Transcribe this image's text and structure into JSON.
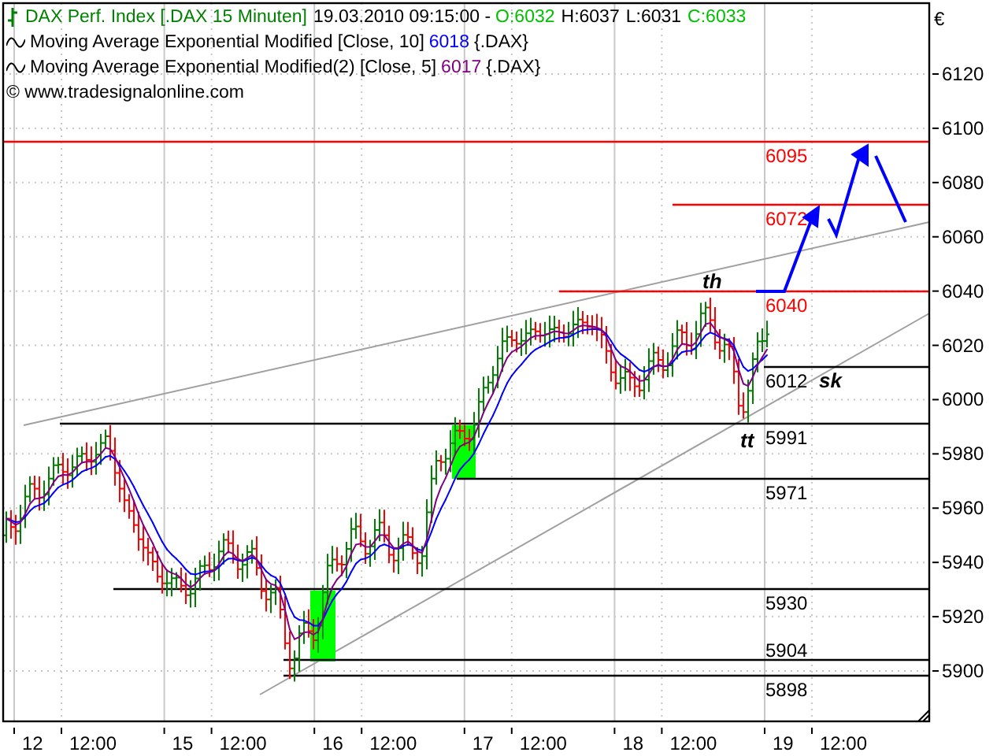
{
  "instrument": {
    "name": "DAX Perf. Index [.DAX  15 Minuten]",
    "datetime": "19.03.2010 09:15:00 -",
    "open": "O:6032",
    "high": "H:6037",
    "low": "L:6031",
    "close": "C:6033"
  },
  "indicators": [
    {
      "label": "Moving Average Exponential Modified [Close, 10]",
      "value": "6018",
      "symbol": "{.DAX}",
      "color": "#0000ff"
    },
    {
      "label": "Moving Average Exponential Modified(2) [Close, 5]",
      "value": "6017",
      "symbol": "{.DAX}",
      "color": "#800080"
    }
  ],
  "copyright": "© www.tradesignalonline.com",
  "y_axis": {
    "currency": "€",
    "ticks": [
      "6120",
      "6100",
      "6080",
      "6060",
      "6040",
      "6020",
      "6000",
      "5980",
      "5960",
      "5940",
      "5920",
      "5900"
    ]
  },
  "x_axis": [
    {
      "label": "12",
      "kind": "day"
    },
    {
      "label": "12:00",
      "kind": "noon"
    },
    {
      "label": "15",
      "kind": "day"
    },
    {
      "label": "12:00",
      "kind": "noon"
    },
    {
      "label": "16",
      "kind": "day"
    },
    {
      "label": "12:00",
      "kind": "noon"
    },
    {
      "label": "17",
      "kind": "day"
    },
    {
      "label": "12:00",
      "kind": "noon"
    },
    {
      "label": "18",
      "kind": "day"
    },
    {
      "label": "12:00",
      "kind": "noon"
    },
    {
      "label": "19",
      "kind": "day"
    },
    {
      "label": "12:00",
      "kind": "noon"
    }
  ],
  "levels": [
    {
      "label": "6095",
      "color": "#ff0000"
    },
    {
      "label": "6072",
      "color": "#ff0000"
    },
    {
      "label": "6040",
      "color": "#ff0000"
    },
    {
      "label": "6012",
      "color": "#000000",
      "note": "sk"
    },
    {
      "label": "5991",
      "color": "#000000"
    },
    {
      "label": "5971",
      "color": "#000000"
    },
    {
      "label": "5930",
      "color": "#000000"
    },
    {
      "label": "5904",
      "color": "#000000"
    },
    {
      "label": "5898",
      "color": "#000000"
    }
  ],
  "annotations": [
    "th",
    "tt"
  ]
}
